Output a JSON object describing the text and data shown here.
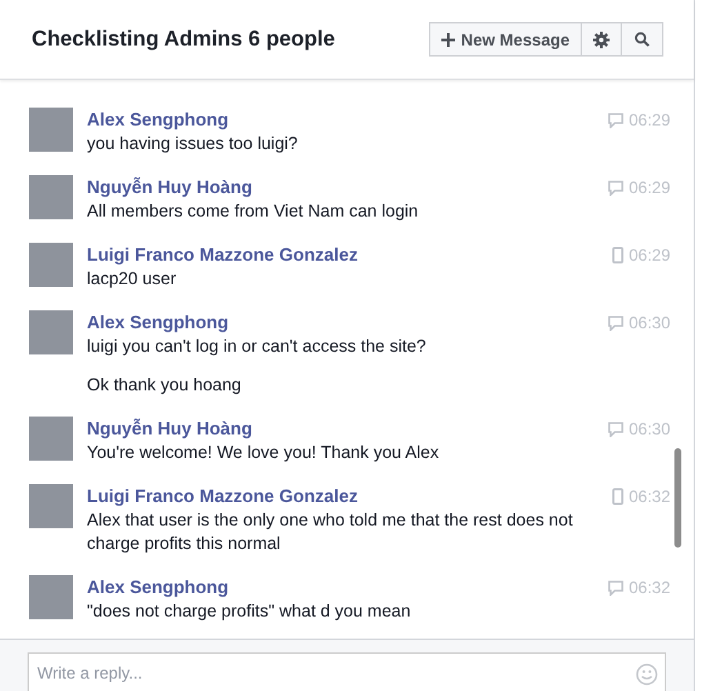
{
  "header": {
    "title": "Checklisting Admins 6 people",
    "buttons": [
      {
        "kind": "new",
        "label": "New Message"
      },
      {
        "kind": "settings"
      },
      {
        "kind": "search"
      }
    ]
  },
  "messages": [
    {
      "sender": "Alex Sengphong",
      "time": "06:29",
      "kind": "chat",
      "lines": [
        "you having issues too luigi?"
      ]
    },
    {
      "sender": "Nguyễn Huy Hoàng",
      "time": "06:29",
      "kind": "chat",
      "lines": [
        "All members come from Viet Nam can login"
      ]
    },
    {
      "sender": "Luigi Franco Mazzone Gonzalez",
      "time": "06:29",
      "kind": "mobile",
      "lines": [
        "lacp20 user"
      ]
    },
    {
      "sender": "Alex Sengphong",
      "time": "06:30",
      "kind": "chat",
      "lines": [
        "luigi you can't log in or can't access the site?",
        "Ok thank you hoang"
      ]
    },
    {
      "sender": "Nguyễn Huy Hoàng",
      "time": "06:30",
      "kind": "chat",
      "lines": [
        "You're welcome!  We love you!  Thank you Alex"
      ]
    },
    {
      "sender": "Luigi Franco Mazzone Gonzalez",
      "time": "06:32",
      "kind": "mobile",
      "lines": [
        "Alex that user is the only one who told me that the rest does not charge profits this normal"
      ]
    },
    {
      "sender": "Alex Sengphong",
      "time": "06:32",
      "kind": "chat",
      "lines": [
        "\"does not charge profits\" what d you mean"
      ]
    }
  ],
  "composer": {
    "placeholder": "Write a reply..."
  }
}
